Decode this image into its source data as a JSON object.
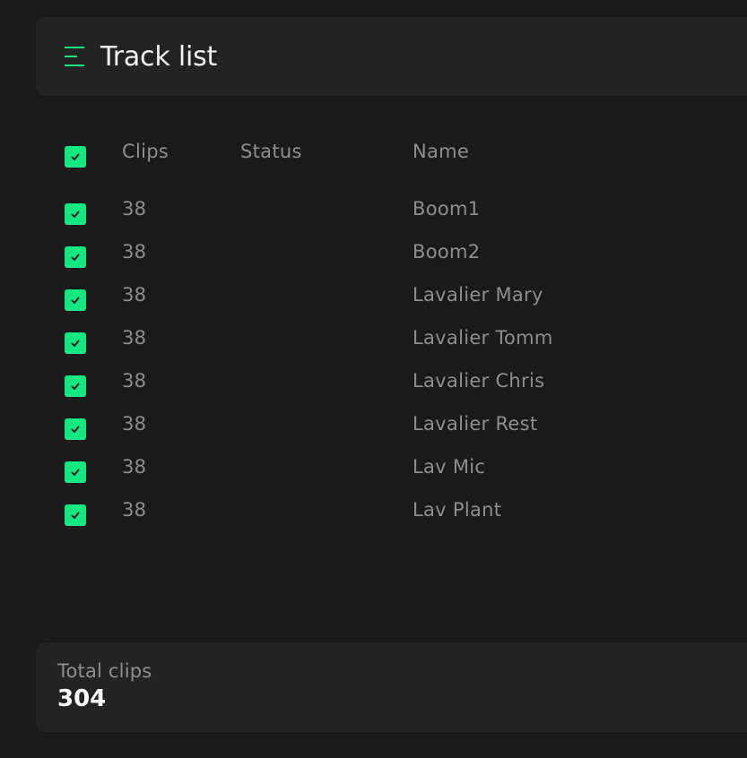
{
  "header": {
    "title": "Track list",
    "icon": "list-icon",
    "accent": "#15e880"
  },
  "columns": {
    "clips": "Clips",
    "status": "Status",
    "name": "Name"
  },
  "rows": [
    {
      "checked": true,
      "clips": "38",
      "status": "",
      "name": "Boom1"
    },
    {
      "checked": true,
      "clips": "38",
      "status": "",
      "name": "Boom2"
    },
    {
      "checked": true,
      "clips": "38",
      "status": "",
      "name": "Lavalier Mary"
    },
    {
      "checked": true,
      "clips": "38",
      "status": "",
      "name": "Lavalier Tomm"
    },
    {
      "checked": true,
      "clips": "38",
      "status": "",
      "name": "Lavalier Chris"
    },
    {
      "checked": true,
      "clips": "38",
      "status": "",
      "name": "Lavalier Rest"
    },
    {
      "checked": true,
      "clips": "38",
      "status": "",
      "name": "Lav Mic"
    },
    {
      "checked": true,
      "clips": "38",
      "status": "",
      "name": "Lav Plant"
    }
  ],
  "summary": {
    "label": "Total clips",
    "value": "304"
  }
}
